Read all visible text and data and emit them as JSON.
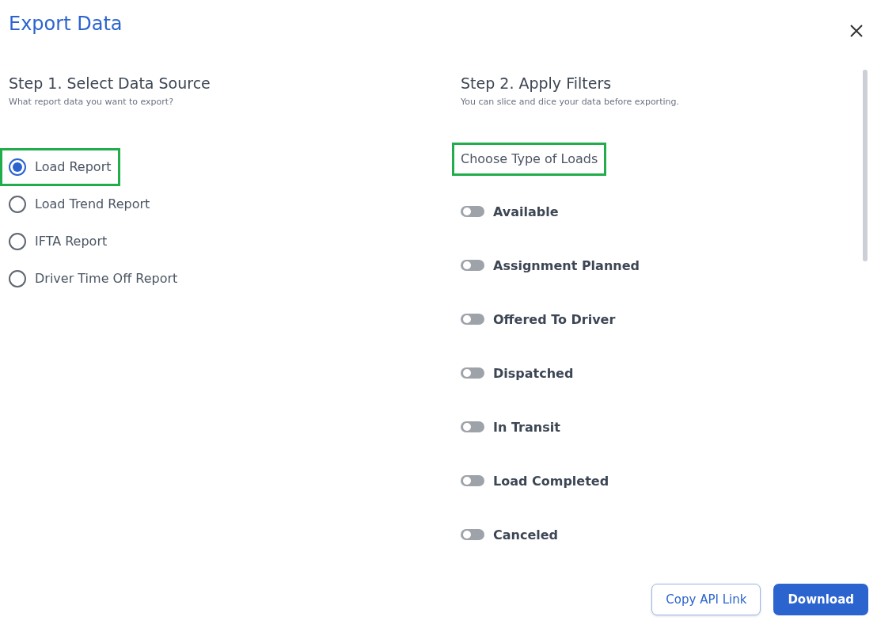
{
  "title": "Export Data",
  "step1": {
    "heading": "Step 1. Select Data Source",
    "subtitle": "What report data you want to export?",
    "options": [
      {
        "label": "Load Report",
        "selected": true,
        "highlighted": true
      },
      {
        "label": "Load Trend Report",
        "selected": false,
        "highlighted": false
      },
      {
        "label": "IFTA Report",
        "selected": false,
        "highlighted": false
      },
      {
        "label": "Driver Time Off Report",
        "selected": false,
        "highlighted": false
      }
    ]
  },
  "step2": {
    "heading": "Step 2. Apply Filters",
    "subtitle": "You can slice and dice your data before exporting.",
    "group_label": "Choose Type of Loads",
    "group_highlighted": true,
    "filters": [
      {
        "label": "Available",
        "on": false
      },
      {
        "label": "Assignment Planned",
        "on": false
      },
      {
        "label": "Offered To Driver",
        "on": false
      },
      {
        "label": "Dispatched",
        "on": false
      },
      {
        "label": "In Transit",
        "on": false
      },
      {
        "label": "Load Completed",
        "on": false
      },
      {
        "label": "Canceled",
        "on": false
      }
    ]
  },
  "buttons": {
    "secondary": "Copy API Link",
    "primary": "Download"
  }
}
